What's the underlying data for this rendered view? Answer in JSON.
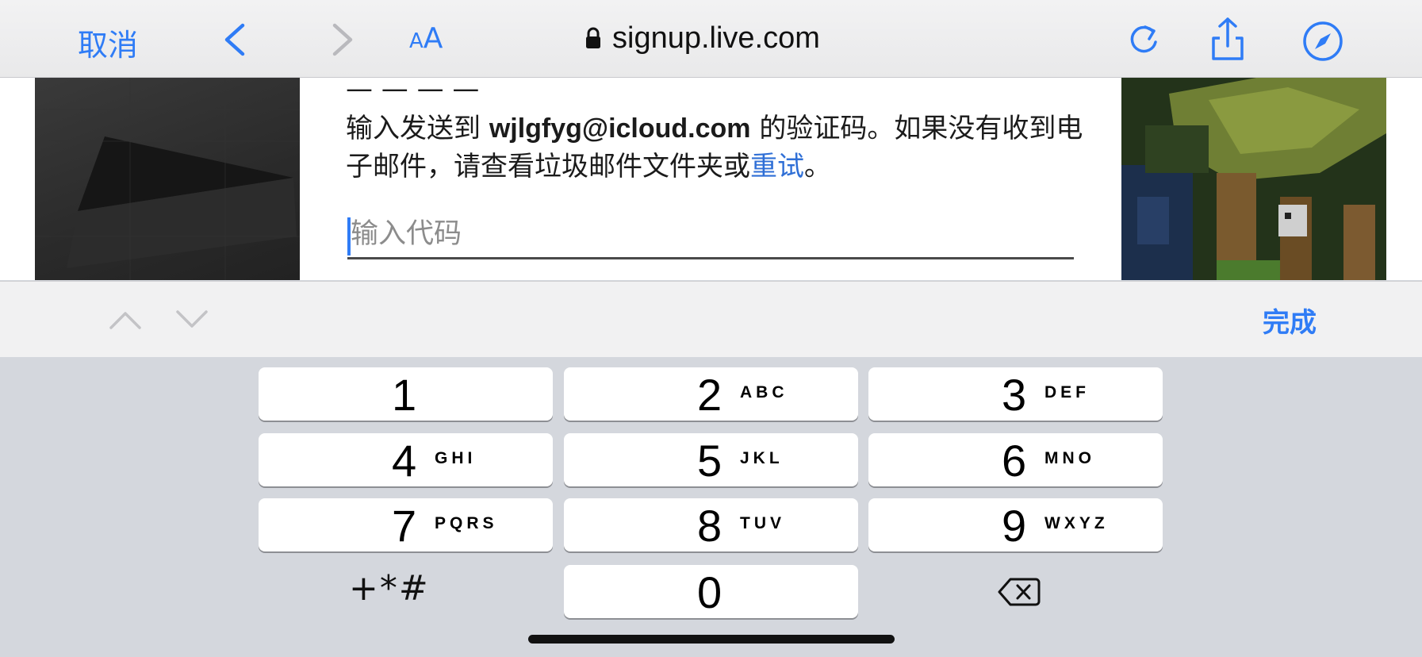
{
  "browser": {
    "cancel_label": "取消",
    "text_size_label_small": "A",
    "text_size_label_large": "A",
    "url": "signup.live.com",
    "icons": {
      "back": "chevron-left-icon",
      "forward": "chevron-right-icon",
      "lock": "lock-icon",
      "reload": "reload-icon",
      "share": "share-icon",
      "compass": "compass-icon"
    },
    "accent_color": "#2f7cf6"
  },
  "page": {
    "clipped_heading": "— — — —",
    "message_before": "输入发送到 ",
    "email": "wjlgfyg@icloud.com",
    "message_middle": " 的验证码。如果没有收到电子邮件，请查看垃圾邮件文件夹或",
    "retry_link": "重试",
    "message_end": "。",
    "code_input": {
      "placeholder": "输入代码",
      "value": ""
    },
    "link_color": "#2f6fd6"
  },
  "accessory_bar": {
    "done_label": "完成",
    "icons": {
      "prev": "chevron-up-icon",
      "next": "chevron-down-icon"
    }
  },
  "keypad": {
    "keys": [
      {
        "digit": "1",
        "letters": ""
      },
      {
        "digit": "2",
        "letters": "ABC"
      },
      {
        "digit": "3",
        "letters": "DEF"
      },
      {
        "digit": "4",
        "letters": "GHI"
      },
      {
        "digit": "5",
        "letters": "JKL"
      },
      {
        "digit": "6",
        "letters": "MNO"
      },
      {
        "digit": "7",
        "letters": "PQRS"
      },
      {
        "digit": "8",
        "letters": "TUV"
      },
      {
        "digit": "9",
        "letters": "WXYZ"
      },
      {
        "digit": "0",
        "letters": ""
      }
    ],
    "symbols_label": "+*#",
    "delete_icon": "backspace-icon"
  }
}
